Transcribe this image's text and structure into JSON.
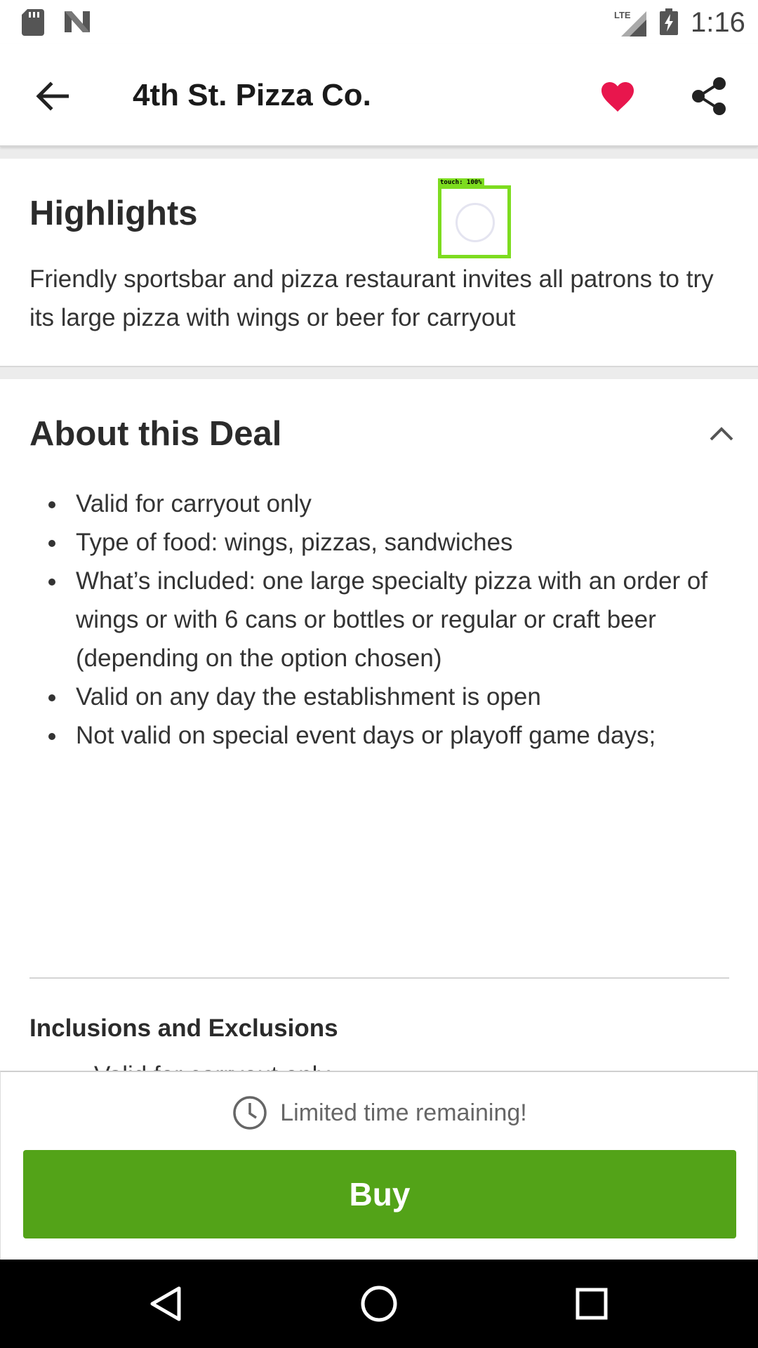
{
  "status_bar": {
    "time": "1:16",
    "icons": [
      "sd-card-icon",
      "n-notification-icon",
      "lte-signal-icon",
      "battery-charging-icon"
    ]
  },
  "app_bar": {
    "title": "4th St. Pizza Co.",
    "icons": [
      "back-arrow-icon",
      "heart-icon",
      "share-icon"
    ],
    "favorite_color": "#e8164d"
  },
  "highlights": {
    "heading": "Highlights",
    "body": "Friendly sportsbar and pizza restaurant invites all patrons to try its large pizza with wings or beer for carryout"
  },
  "touch_marker": {
    "label": "touch: 100%"
  },
  "about": {
    "heading": "About this Deal",
    "collapse_icon": "chevron-up-icon",
    "items": [
      "Valid for carryout only",
      "Type of food: wings, pizzas, sandwiches",
      "What’s included: one large specialty pizza with an order of wings or with 6 cans or bottles or regular or craft beer (depending on the option chosen)",
      "Valid on any day the establishment is open",
      "Not valid on special event days or playoff game days;"
    ],
    "inclusions_heading": "Inclusions and Exclusions",
    "inclusions_peek": "Valid for carryout only"
  },
  "buy_panel": {
    "timer_icon": "clock-icon",
    "timer_text": "Limited time remaining!",
    "buy_label": "Buy",
    "buy_color": "#53a318"
  },
  "nav_bar": {
    "icons": [
      "back-triangle-icon",
      "home-circle-icon",
      "recents-square-icon"
    ]
  }
}
